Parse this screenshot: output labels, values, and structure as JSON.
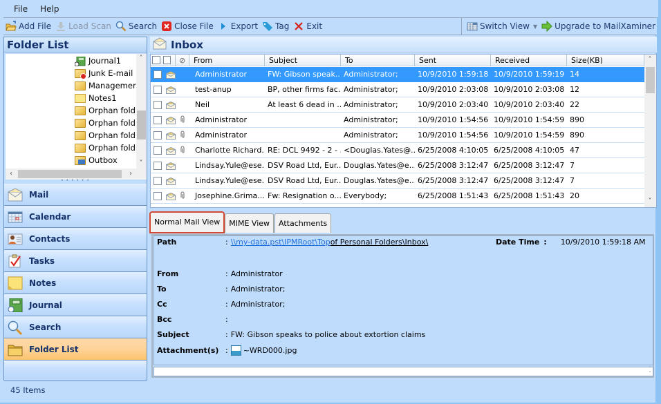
{
  "menu": [
    "File",
    "Help"
  ],
  "toolbar": {
    "add_file": "Add File",
    "load_scan": "Load Scan",
    "search": "Search",
    "close_file": "Close File",
    "export": "Export",
    "tag": "Tag",
    "exit": "Exit",
    "switch_view": "Switch View",
    "upgrade": "Upgrade to MailXaminer"
  },
  "folder_list": {
    "title": "Folder List",
    "items": [
      {
        "label": "Journal1",
        "icon": "journal-icon"
      },
      {
        "label": "Junk E-mail",
        "icon": "junk-folder-icon"
      },
      {
        "label": "Managemer",
        "icon": "folder-icon"
      },
      {
        "label": "Notes1",
        "icon": "notes-icon"
      },
      {
        "label": "Orphan fold",
        "icon": "folder-icon"
      },
      {
        "label": "Orphan fold",
        "icon": "folder-icon"
      },
      {
        "label": "Orphan fold",
        "icon": "folder-icon"
      },
      {
        "label": "Orphan fold",
        "icon": "folder-icon"
      },
      {
        "label": "Outbox",
        "icon": "outbox-icon"
      }
    ]
  },
  "nav": [
    {
      "label": "Mail",
      "icon": "mail-icon"
    },
    {
      "label": "Calendar",
      "icon": "calendar-icon"
    },
    {
      "label": "Contacts",
      "icon": "contacts-icon"
    },
    {
      "label": "Tasks",
      "icon": "tasks-icon"
    },
    {
      "label": "Notes",
      "icon": "notes-icon"
    },
    {
      "label": "Journal",
      "icon": "journal-icon"
    },
    {
      "label": "Search",
      "icon": "search-icon"
    },
    {
      "label": "Folder List",
      "icon": "folder-icon",
      "active": true
    }
  ],
  "status": {
    "items": "45 Items"
  },
  "inbox": {
    "title": "Inbox",
    "columns": [
      "From",
      "Subject",
      "To",
      "Sent",
      "Received",
      "Size(KB)"
    ],
    "rows": [
      {
        "attach": false,
        "from": "Administrator",
        "subject": "FW: Gibson speak...",
        "to": "Administrator;",
        "sent": "10/9/2010 1:59:18 ...",
        "received": "10/9/2010 1:59:19 ...",
        "size": "14",
        "selected": true
      },
      {
        "attach": false,
        "from": "test-anup",
        "subject": "BP, other firms fac...",
        "to": "Administrator;",
        "sent": "10/9/2010 2:03:08 ...",
        "received": "10/9/2010 2:03:08 ...",
        "size": "12"
      },
      {
        "attach": false,
        "from": "Neil",
        "subject": "At least 6 dead in ...",
        "to": "Administrator;",
        "sent": "10/9/2010 2:03:40 ...",
        "received": "10/9/2010 2:03:40 ...",
        "size": "22"
      },
      {
        "attach": true,
        "from": "Administrator",
        "subject": "",
        "to": "Administrator;",
        "sent": "10/9/2010 1:54:56 ...",
        "received": "10/9/2010 1:54:59 ...",
        "size": "890"
      },
      {
        "attach": true,
        "from": "Administrator",
        "subject": "",
        "to": "Administrator;",
        "sent": "10/9/2010 1:54:56 ...",
        "received": "10/9/2010 1:54:59 ...",
        "size": "890"
      },
      {
        "attach": true,
        "from": "Charlotte Richard...",
        "subject": "RE: DCL 9492 - 2 - ...",
        "to": "<Douglas.Yates@...",
        "sent": "6/25/2008 4:10:05 ...",
        "received": "6/25/2008 4:10:05 ...",
        "size": "47"
      },
      {
        "attach": false,
        "from": "Lindsay.Yule@ese...",
        "subject": "DSV Road Ltd, Eur...",
        "to": "Douglas.Yates@e...",
        "sent": "6/25/2008 3:12:47 ...",
        "received": "6/25/2008 3:12:47 ...",
        "size": "7"
      },
      {
        "attach": false,
        "from": "Lindsay.Yule@ese...",
        "subject": "DSV Road Ltd, Eur...",
        "to": "Douglas.Yates@e...",
        "sent": "6/25/2008 3:12:47 ...",
        "received": "6/25/2008 3:12:47 ...",
        "size": "7"
      },
      {
        "attach": true,
        "from": "Josephine.Grima...",
        "subject": "Fw: Resignation o...",
        "to": "Everybody;",
        "sent": "6/25/2008 1:51:43 ...",
        "received": "6/25/2008 1:51:43 ...",
        "size": "20"
      }
    ]
  },
  "tabs": [
    "Normal Mail View",
    "MIME View",
    "Attachments"
  ],
  "detail": {
    "path_label": "Path",
    "path_link": "\\\\my-data.pst\\IPMRoot\\Top",
    "path_rest": " of Personal Folders\\Inbox\\",
    "datetime_label": "Date Time",
    "datetime_value": "10/9/2010 1:59:18 AM",
    "from_label": "From",
    "from_value": "Administrator",
    "to_label": "To",
    "to_value": "Administrator;",
    "cc_label": "Cc",
    "cc_value": "Administrator;",
    "bcc_label": "Bcc",
    "bcc_value": "",
    "subject_label": "Subject",
    "subject_value": "FW: Gibson speaks to police about extortion claims",
    "attachments_label": "Attachment(s)",
    "attachment_file": "~WRD000.jpg",
    "colon": ":"
  }
}
